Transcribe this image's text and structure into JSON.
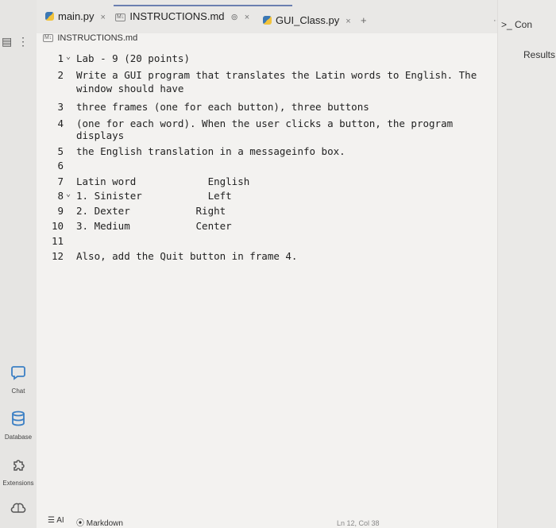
{
  "tabs": [
    {
      "label": "main.py",
      "icon": "python-icon",
      "close": "×"
    },
    {
      "label": "INSTRUCTIONS.md",
      "icon": "markdown-icon",
      "preview": "⊚",
      "close": "×"
    },
    {
      "label": "GUI_Class.py",
      "icon": "python-icon",
      "close": "×"
    }
  ],
  "tabbar": {
    "add": "+",
    "more": "···"
  },
  "breadcrumb": "INSTRUCTIONS.md",
  "sidebar_top": {
    "panel_icon": "▤",
    "menu": "⋮"
  },
  "code_lines": [
    {
      "n": "1",
      "fold": "⌄",
      "text": "Lab - 9 (20 points)"
    },
    {
      "n": "2",
      "fold": "",
      "text": "Write a GUI program that translates the Latin words to English. The"
    },
    {
      "n": "",
      "fold": "",
      "text": "window should have"
    },
    {
      "n": "3",
      "fold": "",
      "text": "three frames (one for each button), three buttons"
    },
    {
      "n": "4",
      "fold": "",
      "text": "(one for each word). When the user clicks a button, the program"
    },
    {
      "n": "",
      "fold": "",
      "text": "displays"
    },
    {
      "n": "5",
      "fold": "",
      "text": "the English translation in a messageinfo box."
    },
    {
      "n": "6",
      "fold": "",
      "text": ""
    },
    {
      "n": "7",
      "fold": "",
      "text": "Latin word            English"
    },
    {
      "n": "8",
      "fold": "⌄",
      "text": "1. Sinister           Left"
    },
    {
      "n": "9",
      "fold": "",
      "text": "2. Dexter           Right"
    },
    {
      "n": "10",
      "fold": "",
      "text": "3. Medium           Center"
    },
    {
      "n": "11",
      "fold": "",
      "text": ""
    },
    {
      "n": "12",
      "fold": "",
      "text": "Also, add the Quit button in frame 4."
    }
  ],
  "sidebar_tools": [
    {
      "label": "Chat",
      "icon": "chat-icon"
    },
    {
      "label": "Database",
      "icon": "database-icon"
    },
    {
      "label": "Extensions",
      "icon": "extensions-icon"
    },
    {
      "label": "",
      "icon": "brain-icon"
    }
  ],
  "status": {
    "ai": "AI",
    "language": "Markdown",
    "position": "Ln 12, Col 38"
  },
  "right_panel": {
    "console": "Con",
    "results": "Results"
  }
}
